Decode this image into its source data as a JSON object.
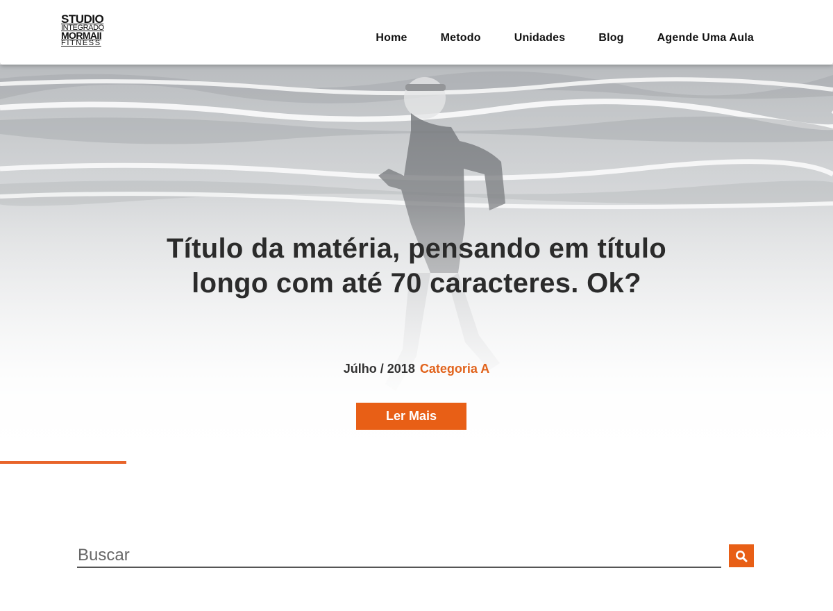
{
  "logo": {
    "line1": "STUDIO",
    "line2": "INTEGRADO",
    "line3": "MORMAII",
    "line4": "FITNESS"
  },
  "nav": {
    "items": [
      "Home",
      "Metodo",
      "Unidades",
      "Blog",
      "Agende Uma Aula"
    ]
  },
  "hero": {
    "title": "Título da matéria, pensando em título longo com até 70 caracteres. Ok?",
    "date": "Júlho / 2018",
    "category": "Categoria A",
    "button_label": "Ler Mais",
    "image_icon": "runner-on-beach-photo"
  },
  "search": {
    "placeholder": "Buscar",
    "value": "",
    "button_icon": "search-icon"
  },
  "colors": {
    "accent": "#e85f16",
    "text_dark": "#2b2b2b",
    "category": "#e1631c"
  }
}
